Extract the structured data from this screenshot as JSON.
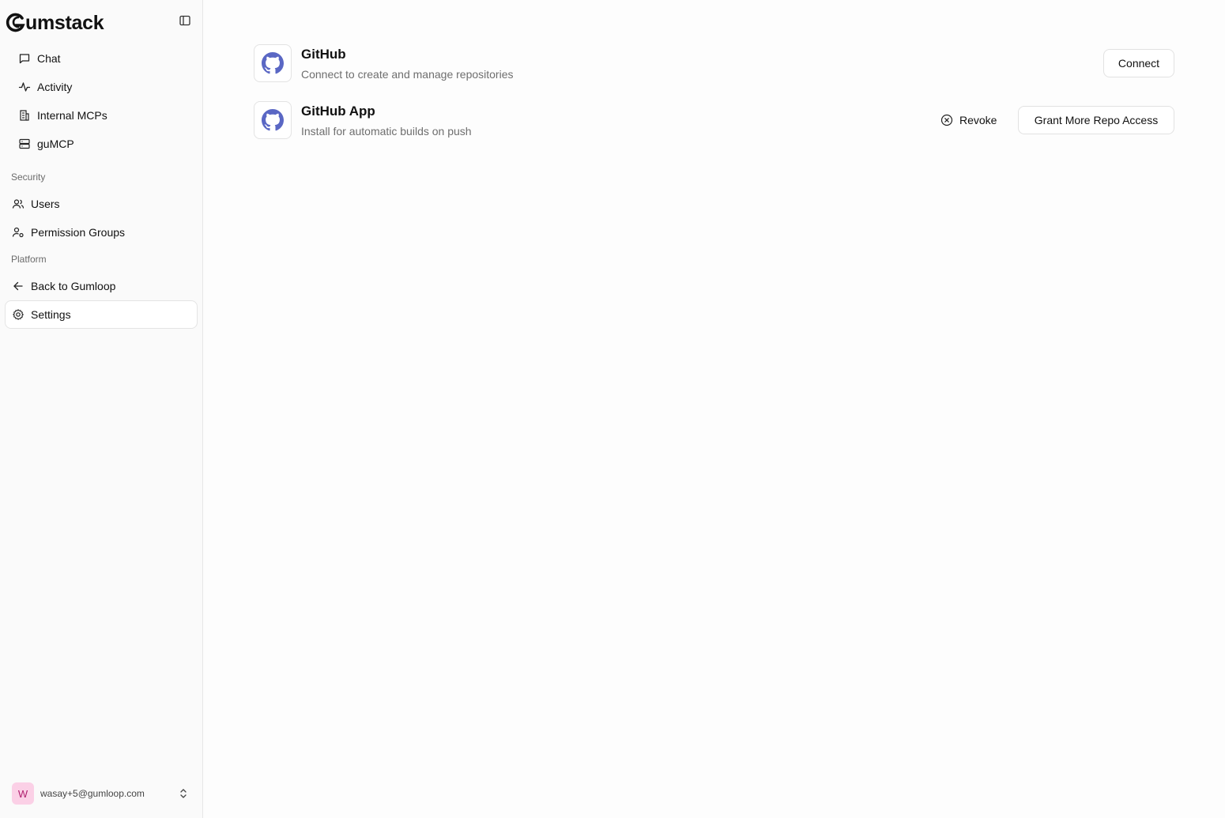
{
  "brand": {
    "name": "umstack"
  },
  "sidebar": {
    "items": [
      {
        "label": "Chat"
      },
      {
        "label": "Activity"
      },
      {
        "label": "Internal MCPs"
      },
      {
        "label": "guMCP"
      }
    ],
    "sections": [
      {
        "title": "Security",
        "items": [
          {
            "label": "Users"
          },
          {
            "label": "Permission Groups"
          }
        ]
      },
      {
        "title": "Platform",
        "items": [
          {
            "label": "Back to Gumloop"
          },
          {
            "label": "Settings",
            "active": true
          }
        ]
      }
    ],
    "user": {
      "initial": "W",
      "email": "wasay+5@gumloop.com"
    }
  },
  "integrations": [
    {
      "title": "GitHub",
      "description": "Connect to create and manage repositories",
      "connect_label": "Connect"
    },
    {
      "title": "GitHub App",
      "description": "Install for automatic builds on push",
      "revoke_label": "Revoke",
      "grant_label": "Grant More Repo Access"
    }
  ],
  "colors": {
    "github_logo": "#5a67c4",
    "avatar_bg": "#fbd0e6",
    "avatar_fg": "#b0206f"
  }
}
